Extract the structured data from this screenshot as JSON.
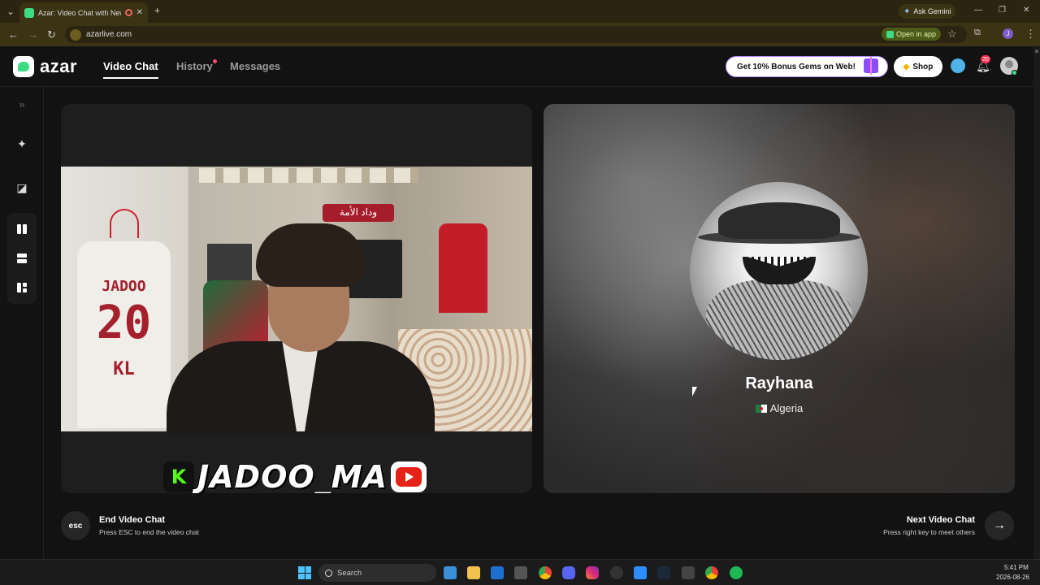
{
  "browser": {
    "tab_title": "Azar: Video Chat with New",
    "tab_close": "✕",
    "new_tab": "+",
    "ask_gemini": "Ask Gemini",
    "url": "azarlive.com",
    "open_in_app": "Open in app",
    "window_min": "—",
    "window_restore": "❐",
    "window_close": "✕"
  },
  "header": {
    "logo_text": "azar",
    "nav": [
      {
        "label": "Video Chat",
        "active": true
      },
      {
        "label": "History",
        "has_dot": true
      },
      {
        "label": "Messages"
      }
    ],
    "bonus_label": "Get 10% Bonus Gems on Web!",
    "shop_label": "Shop",
    "notification_count": "20"
  },
  "sidebar": {
    "expand_icon": "»",
    "icons": [
      "magic-wand-icon",
      "sticker-icon",
      "layout-side-by-side-icon",
      "layout-stacked-icon",
      "layout-grid-icon"
    ]
  },
  "self_view": {
    "streamer_name": "JADOO_MA",
    "jersey_name": "JADOO",
    "jersey_number": "20",
    "jersey_extra": "KL",
    "banner_text": "وداد الأمة"
  },
  "partner": {
    "name": "Rayhana",
    "country": "Algeria"
  },
  "controls": {
    "esc_key": "esc",
    "end_title": "End Video Chat",
    "end_subtitle": "Press ESC to end the video chat",
    "next_title": "Next Video Chat",
    "next_subtitle": "Press right key to meet others",
    "next_arrow": "→"
  },
  "taskbar": {
    "search_label": "Search",
    "time": "5:41 PM",
    "date": "2026-08-26"
  },
  "colors": {
    "accent_green": "#3ddc84",
    "notification_red": "#ff3355",
    "chrome_bg": "#3b3314"
  }
}
